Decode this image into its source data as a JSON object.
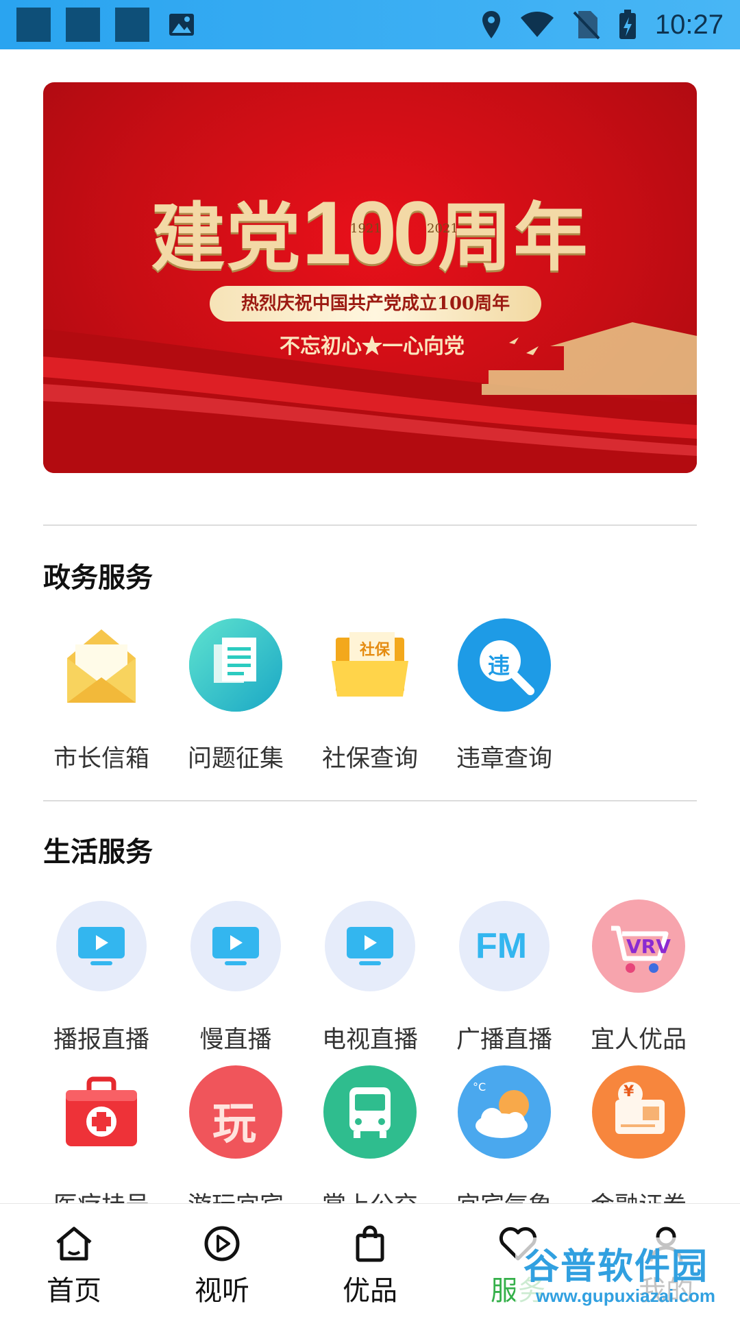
{
  "status_bar": {
    "time": "10:27"
  },
  "banner": {
    "title_left": "建党",
    "title_number": "100",
    "title_right": "周年",
    "year_start": "1921",
    "year_end": "2021",
    "subtitle": "热烈庆祝中国共产党成立100周年",
    "slogan": "不忘初心★一心向党"
  },
  "gov_section": {
    "title": "政务服务",
    "items": [
      {
        "label": "市长信箱",
        "icon": "envelope-icon"
      },
      {
        "label": "问题征集",
        "icon": "document-icon"
      },
      {
        "label": "社保查询",
        "icon": "folder-icon",
        "icon_text": "社保"
      },
      {
        "label": "违章查询",
        "icon": "search-icon",
        "icon_text": "违"
      }
    ]
  },
  "life_section": {
    "title": "生活服务",
    "row1": [
      {
        "label": "播报直播",
        "icon": "tv-play-icon"
      },
      {
        "label": "慢直播",
        "icon": "tv-play-icon"
      },
      {
        "label": "电视直播",
        "icon": "tv-play-icon"
      },
      {
        "label": "广播直播",
        "icon": "fm-radio-icon",
        "icon_text": "FM"
      },
      {
        "label": "宜人优品",
        "icon": "shopping-cart-icon"
      }
    ],
    "row2": [
      {
        "label": "医疗挂号",
        "icon": "medical-kit-icon"
      },
      {
        "label": "游玩宜宾",
        "icon": "play-icon",
        "icon_text": "玩"
      },
      {
        "label": "掌上公交",
        "icon": "bus-icon"
      },
      {
        "label": "宜宾气象",
        "icon": "weather-icon",
        "icon_text": "°C"
      },
      {
        "label": "金融证券",
        "icon": "finance-card-icon",
        "icon_text": "¥"
      }
    ]
  },
  "bottom_nav": [
    {
      "label": "首页",
      "icon": "home-icon"
    },
    {
      "label": "视听",
      "icon": "play-circle-icon"
    },
    {
      "label": "优品",
      "icon": "shopping-bag-icon"
    },
    {
      "label": "服务",
      "icon": "heart-icon"
    },
    {
      "label": "我的",
      "icon": "user-icon"
    }
  ],
  "watermark": {
    "title": "谷普软件园",
    "url": "www.gupuxiazai.com"
  },
  "colors": {
    "accent": "#35b04a",
    "status_bar": "#2aa4f0",
    "banner_red": "#d50f18",
    "gold": "#f3d9a6"
  }
}
